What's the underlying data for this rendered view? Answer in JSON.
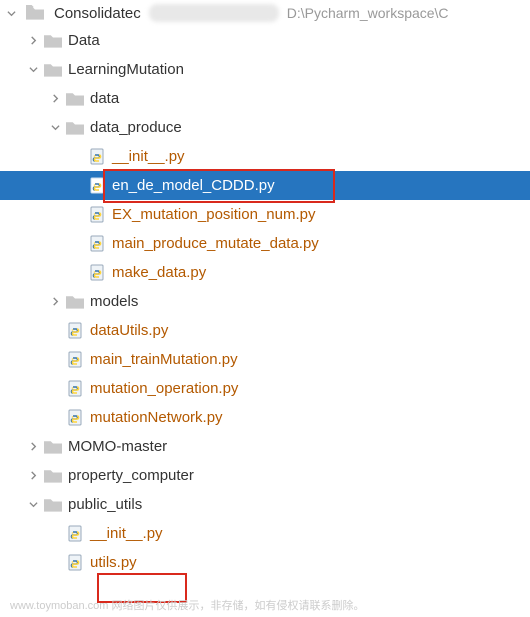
{
  "header": {
    "root_name": "Consolidatec",
    "path_suffix": "D:\\Pycharm_workspace\\C"
  },
  "tree": {
    "data": "Data",
    "learning_mutation": "LearningMutation",
    "lm_data": "data",
    "data_produce": "data_produce",
    "dp_init": "__init__.py",
    "dp_en_de": "en_de_model_CDDD.py",
    "dp_ex": "EX_mutation_position_num.py",
    "dp_main": "main_produce_mutate_data.py",
    "dp_make": "make_data.py",
    "models": "models",
    "dataUtils": "dataUtils.py",
    "main_train": "main_trainMutation.py",
    "mutation_op": "mutation_operation.py",
    "mutation_net": "mutationNetwork.py",
    "momo": "MOMO-master",
    "property_computer": "property_computer",
    "public_utils": "public_utils",
    "pu_init": "__init__.py",
    "pu_utils": "utils.py"
  },
  "watermark": "www.toymoban.com 网络图片仅供展示，非存储，如有侵权请联系删除。"
}
